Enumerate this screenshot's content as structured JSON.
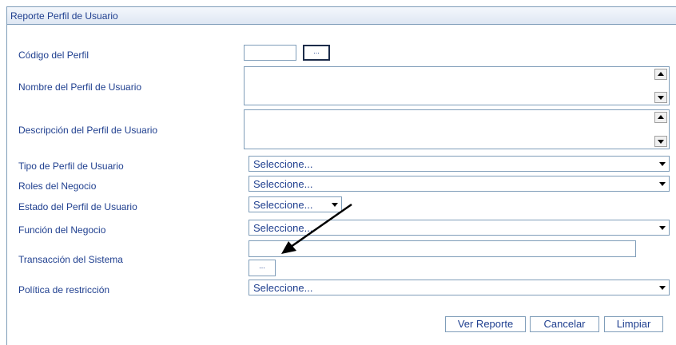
{
  "panel": {
    "title": "Reporte Perfil de Usuario"
  },
  "fields": {
    "codigo_perfil": {
      "label": "Código del Perfil",
      "lookup_label": "..."
    },
    "nombre_perfil": {
      "label": "Nombre del Perfil de Usuario"
    },
    "descripcion_perfil": {
      "label": "Descripción del Perfil de Usuario"
    },
    "tipo_perfil": {
      "label": "Tipo de Perfil de Usuario",
      "selected": "Seleccione..."
    },
    "roles_negocio": {
      "label": "Roles del Negocio",
      "selected": "Seleccione..."
    },
    "estado_perfil": {
      "label": "Estado del Perfil de Usuario",
      "selected": "Seleccione..."
    },
    "funcion_negocio": {
      "label": "Función del Negocio",
      "selected": "Seleccione..."
    },
    "transaccion_sistema": {
      "label": "Transacción del Sistema",
      "lookup_label": "..."
    },
    "politica_restriccion": {
      "label": "Política de restricción",
      "selected": "Seleccione..."
    }
  },
  "buttons": {
    "ver_reporte": "Ver Reporte",
    "cancelar": "Cancelar",
    "limpiar": "Limpiar"
  },
  "icons": {
    "scroll_up": "scroll-up-arrow-icon",
    "scroll_down": "scroll-down-arrow-icon",
    "dropdown": "chevron-down-icon",
    "annotation": "annotation-arrow-icon"
  }
}
